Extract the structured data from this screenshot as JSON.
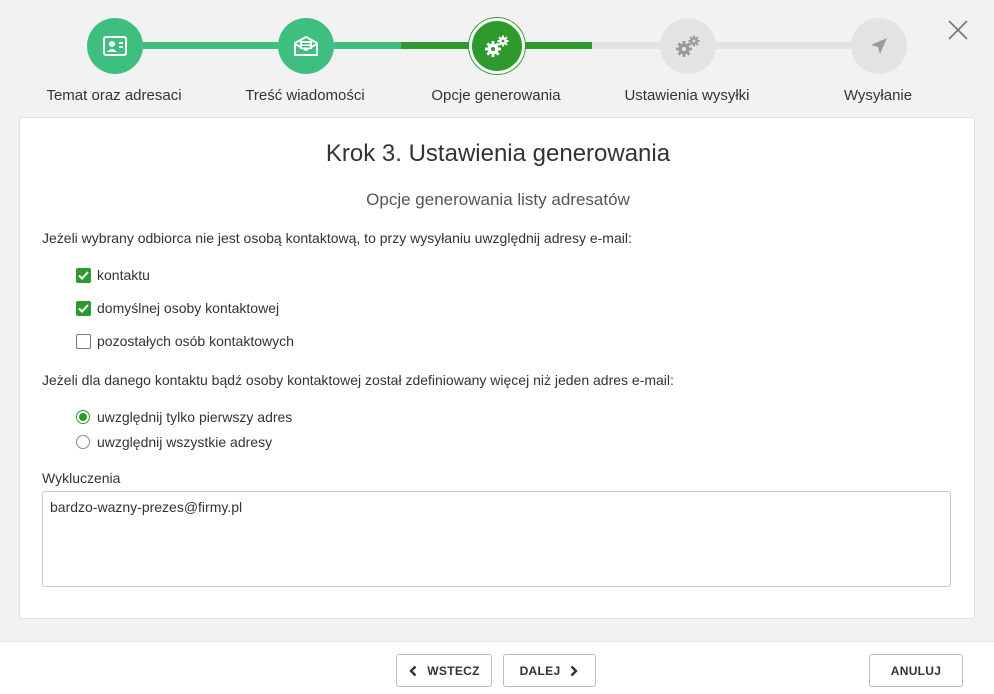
{
  "colors": {
    "done": "#3fbf7f",
    "active": "#2e9a2e",
    "pending": "#e3e3e3",
    "checkbox": "#2e9a2e"
  },
  "wizard": {
    "steps": [
      {
        "label": "Temat oraz adresaci",
        "state": "done",
        "icon": "contact-card-icon"
      },
      {
        "label": "Treść wiadomości",
        "state": "done",
        "icon": "envelope-icon"
      },
      {
        "label": "Opcje generowania",
        "state": "active",
        "icon": "gears-icon"
      },
      {
        "label": "Ustawienia wysyłki",
        "state": "pending",
        "icon": "gears-icon"
      },
      {
        "label": "Wysyłanie",
        "state": "pending",
        "icon": "paper-plane-icon"
      }
    ]
  },
  "main": {
    "title": "Krok 3. Ustawienia generowania",
    "subtitle": "Opcje generowania listy adresatów",
    "question1": "Jeżeli wybrany odbiorca nie jest osobą kontaktową, to przy wysyłaniu uwzględnij adresy e-mail:",
    "checkboxes": [
      {
        "label": "kontaktu",
        "checked": true
      },
      {
        "label": "domyślnej osoby kontaktowej",
        "checked": true
      },
      {
        "label": "pozostałych osób kontaktowych",
        "checked": false
      }
    ],
    "question2": "Jeżeli dla danego kontaktu bądź osoby kontaktowej został zdefiniowany więcej niż jeden adres e-mail:",
    "radios": [
      {
        "label": "uwzględnij tylko pierwszy adres",
        "checked": true
      },
      {
        "label": "uwzględnij wszystkie adresy",
        "checked": false
      }
    ],
    "exclusions_label": "Wykluczenia",
    "exclusions_value": "bardzo-wazny-prezes@firmy.pl"
  },
  "footer": {
    "back_label": "WSTECZ",
    "next_label": "DALEJ",
    "cancel_label": "ANULUJ"
  }
}
